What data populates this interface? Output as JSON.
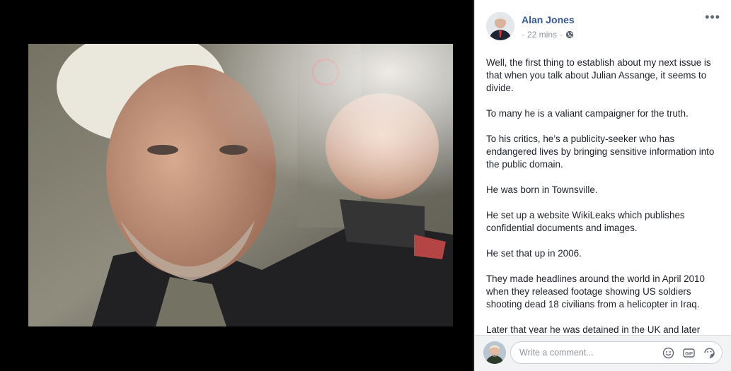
{
  "post": {
    "author": "Alan Jones",
    "time": "22 mins",
    "separator_before": "·",
    "separator_after": "·",
    "privacy_icon": "globe-icon",
    "more_label": "•••",
    "paragraphs": [
      "Well, the first thing to establish about my next issue is that when you talk about Julian Assange, it seems to divide.",
      "To many he is a valiant campaigner for the truth.",
      "To his critics, he’s a publicity-seeker who has endangered lives by bringing sensitive information into the public domain.",
      "He was born in Townsville.",
      "He set up a website WikiLeaks which publishes confidential documents and images.",
      "He set that up in 2006.",
      "They made headlines around the world in April 2010 when they released footage showing US soldiers shooting dead 18 civilians from a helicopter in Iraq.",
      "Later that year he was detained in the UK and later"
    ]
  },
  "comment": {
    "placeholder": "Write a comment...",
    "icons": [
      "emoji-icon",
      "gif-icon",
      "sticker-icon"
    ],
    "gif_label": "GIF"
  },
  "photo": {
    "description_icon": "photo-image"
  },
  "colors": {
    "author_link": "#365899",
    "meta_gray": "#90949c",
    "panel_bg": "#ffffff",
    "viewer_bg": "#000000"
  }
}
